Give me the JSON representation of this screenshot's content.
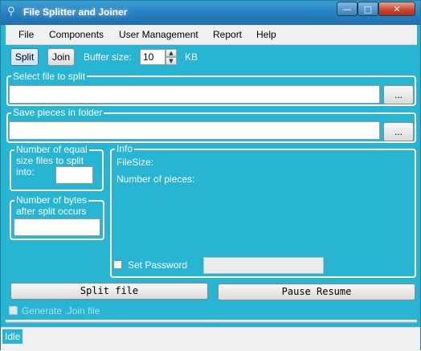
{
  "window": {
    "title": "File Splitter and Joiner",
    "minimize_glyph": "—",
    "maximize_glyph": "□",
    "close_glyph": "✕"
  },
  "menu": {
    "items": [
      "File",
      "Components",
      "User Management",
      "Report",
      "Help"
    ]
  },
  "toolbar": {
    "split_label": "Split",
    "join_label": "Join",
    "buffer_label": "Buffer size:",
    "buffer_value": "10",
    "buffer_unit": "KB"
  },
  "select_file": {
    "title": "Select file to split",
    "value": "",
    "browse_label": "..."
  },
  "save_folder": {
    "title": "Save pieces in folder",
    "value": "",
    "browse_label": "..."
  },
  "equal_files": {
    "title": "Number of equal size files to split into:",
    "title_lines": [
      "Number of equal",
      "size files to split",
      "into:"
    ],
    "value": ""
  },
  "bytes_split": {
    "title_lines": [
      "Number of bytes",
      "after split occurs"
    ],
    "value": ""
  },
  "info": {
    "title": "Info",
    "filesize_label": "FileSize:",
    "pieces_label": "Number of pieces:",
    "set_password_label": "Set Password",
    "password_value": ""
  },
  "actions": {
    "split_file_label": "Split file",
    "pause_resume_label": "Pause Resume"
  },
  "generate_join": {
    "label": "Generate .Join file",
    "checked": true
  },
  "status": {
    "text": "Idle"
  },
  "icons": {
    "app": "splitter-app-icon",
    "spin_up": "chevron-up-icon",
    "spin_down": "chevron-down-icon"
  },
  "colors": {
    "background": "#27b5d3",
    "titlebar": "#2a84c2",
    "menubar": "#f0f0f0"
  }
}
